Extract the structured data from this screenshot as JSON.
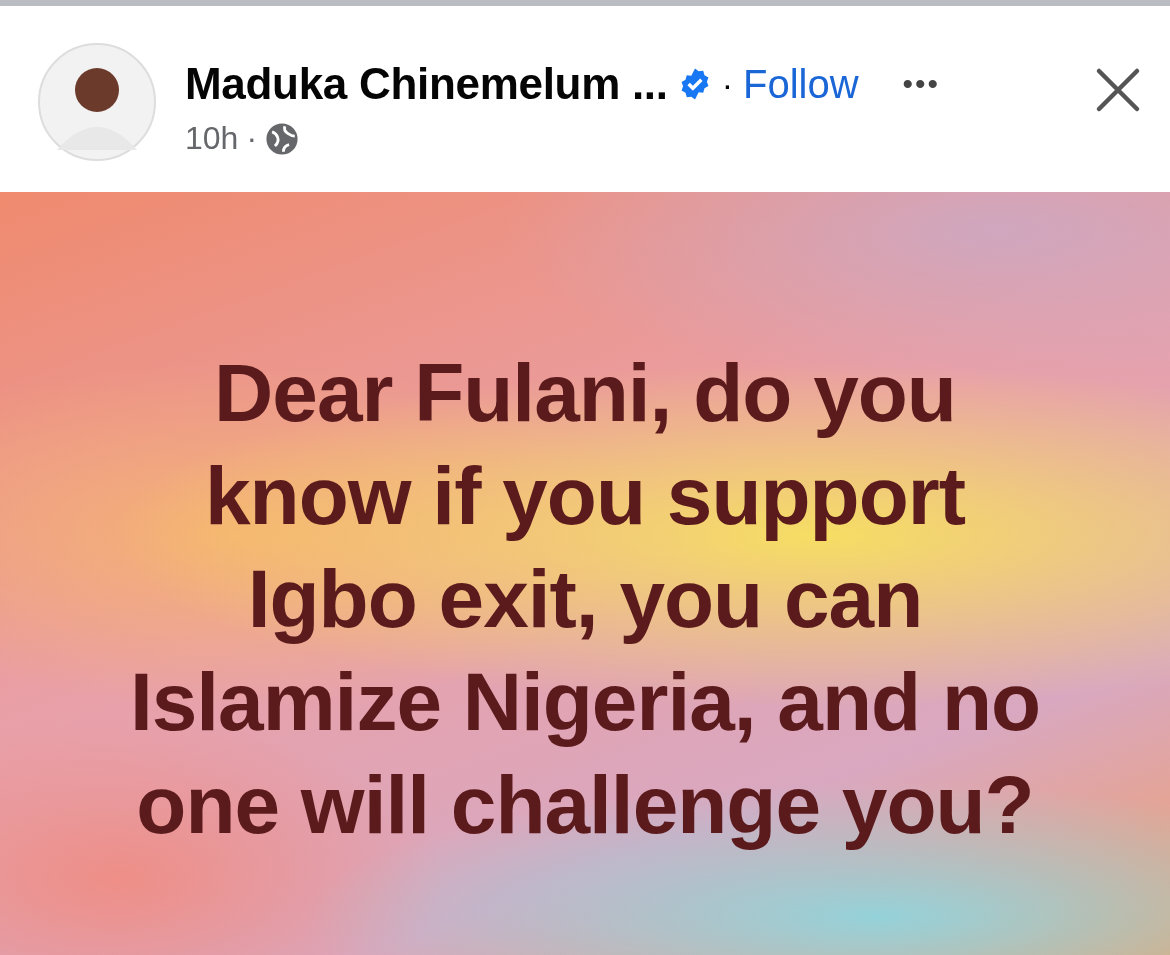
{
  "post": {
    "author": "Maduka Chinemelum ...",
    "verified": true,
    "follow": "Follow",
    "separator": "·",
    "time": "10h",
    "time_separator": "·",
    "more": "•••"
  },
  "card": {
    "lines": [
      "Dear Fulani, do you",
      "know if you support",
      "Igbo exit, you can",
      "Islamize Nigeria, and no",
      "one will challenge you?"
    ]
  }
}
